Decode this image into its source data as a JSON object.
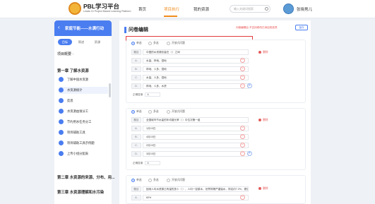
{
  "header": {
    "app_title": "PBL学习平台",
    "app_subtitle": "Leads Or Project Based Learning Platform",
    "nav": [
      "首页",
      "项目执行",
      "我的资源"
    ],
    "search_placeholder": "输入关键词搜索",
    "user_name": "张晓男儿"
  },
  "sidebar": {
    "title": "家庭节能——水满行动",
    "tabs": [
      "目标",
      "简述",
      "资源"
    ],
    "project_overview": "项目概要",
    "chapter1": "第一章 了解水资源",
    "items": [
      "了解中国水资源",
      "水资源统计",
      "反思",
      "水资源由谁分工",
      "节约用水任务分工",
      "项目辅助工具",
      "项目辅助工具示例题",
      "上传小组分配表"
    ],
    "chapter2": "第二章 水资源的来源、分布、用...",
    "chapter3": "第三章 水资源理解和水污染"
  },
  "main": {
    "title": "问卷编辑",
    "hint": "问卷编辑后 不支持修改已添加的选项",
    "save_label": "保存",
    "type_options": [
      "单选",
      "多选",
      "开放式问题"
    ],
    "delete_label": "删除",
    "answer_label": "正确答案",
    "questions": [
      {
        "stem_label": "题目",
        "stem": "中国的水资源总量在（ ）之间",
        "options": [
          {
            "label": "A.",
            "text": "水量、林地、湿地"
          },
          {
            "label": "B.",
            "text": "林地、人多、湿地"
          },
          {
            "label": "C.",
            "text": "水量、人多、湿地"
          },
          {
            "label": "D.",
            "text": "林地、人多、水资"
          }
        ],
        "answer": "A"
      },
      {
        "stem_label": "题目",
        "stem": "全国城市节水量的年均增长率（ ）中位次第一组",
        "options": [
          {
            "label": "A.",
            "text": "1月15日"
          },
          {
            "label": "B.",
            "text": "4月15日"
          },
          {
            "label": "C.",
            "text": "2月15日"
          },
          {
            "label": "D.",
            "text": "3月15日"
          }
        ],
        "answer": "A"
      },
      {
        "stem_label": "题目",
        "stem": "因地人均水资源占有量的多少（ ），人均一定耕水，世界排第严重缺水，排名约7.2%，更加江口",
        "options": [
          {
            "label": "A.",
            "text": "60%"
          }
        ],
        "answer": ""
      }
    ]
  }
}
